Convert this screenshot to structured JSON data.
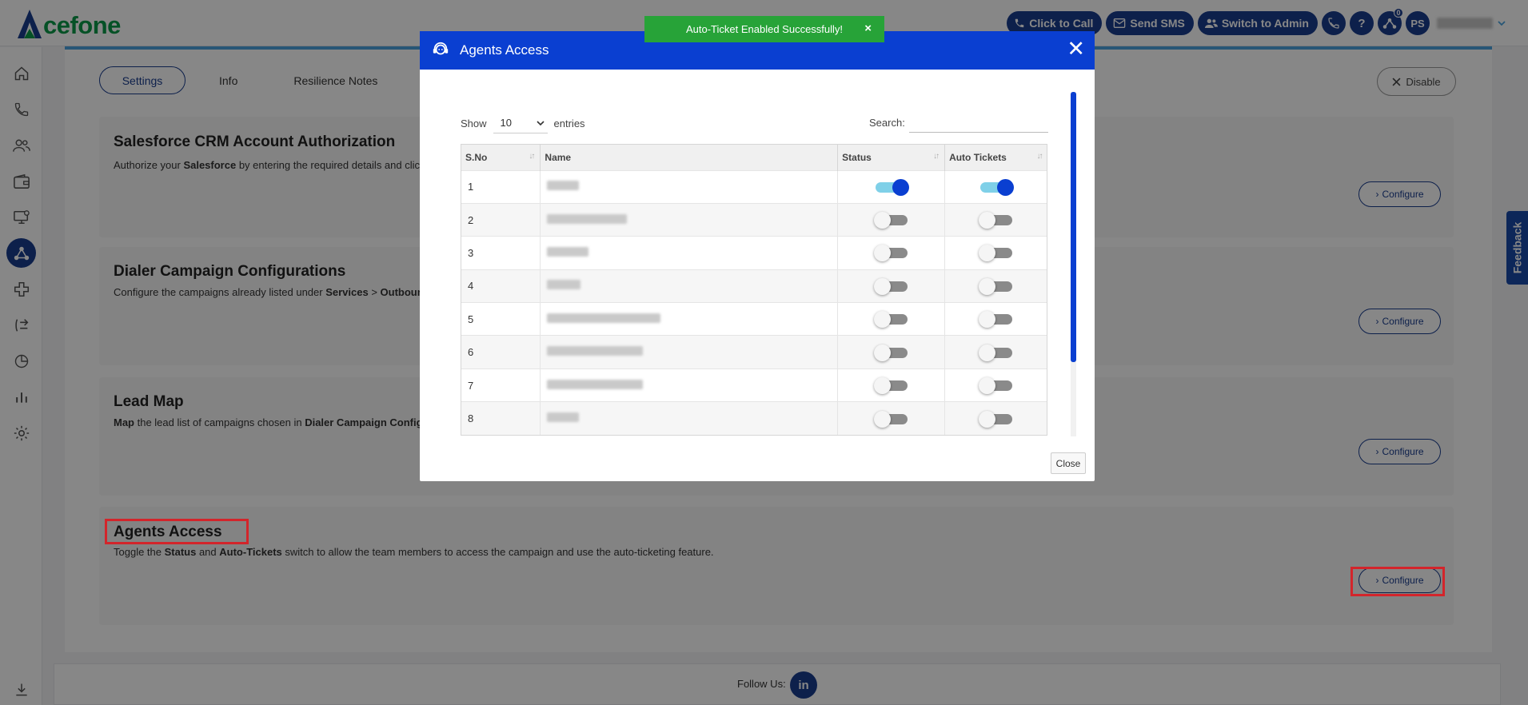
{
  "brand": {
    "logo_text": "cefone"
  },
  "header": {
    "click_to_call": "Click to Call",
    "send_sms": "Send SMS",
    "switch_to_admin": "Switch to Admin",
    "help": "?",
    "badge": "0",
    "avatar_initials": "PS"
  },
  "tabs": [
    {
      "label": "Settings",
      "active": true
    },
    {
      "label": "Info",
      "active": false
    },
    {
      "label": "Resilience Notes",
      "active": false
    }
  ],
  "disable_label": "Disable",
  "sections": [
    {
      "title": "Salesforce CRM Account Authorization",
      "desc_a": "Authorize your ",
      "desc_b": "Salesforce",
      "desc_c": " by entering the required details and clic",
      "configure": "Configure"
    },
    {
      "title": "Dialer Campaign Configurations",
      "desc_a": "Configure the campaigns already listed under ",
      "desc_b": "Services",
      "desc_c": " > ",
      "desc_d": "Outboun",
      "configure": "Configure"
    },
    {
      "title": "Lead Map",
      "desc_a": "Map",
      "desc_b": " the lead list of campaigns chosen in ",
      "desc_c": "Dialer Campaign Config",
      "configure": "Configure"
    },
    {
      "title": "Agents Access",
      "desc_a": "Toggle the ",
      "desc_b": "Status",
      "desc_c": " and ",
      "desc_d": "Auto-Tickets",
      "desc_e": " switch to allow the team members to access the campaign and use the auto-ticketing feature.",
      "configure": "Configure"
    }
  ],
  "feedback": "Feedback",
  "footer": {
    "follow_us": "Follow Us:",
    "linkedin": "in"
  },
  "toast": {
    "message": "Auto-Ticket Enabled Successfully!",
    "close": "×"
  },
  "modal": {
    "title": "Agents Access",
    "close_icon": "✕",
    "show_label": "Show",
    "entries_value": "10",
    "entries_label": "entries",
    "search_label": "Search:",
    "search_value": "",
    "columns": [
      "S.No",
      "Name",
      "Status",
      "Auto Tickets"
    ],
    "rows": [
      {
        "sno": "1",
        "status": true,
        "auto": true
      },
      {
        "sno": "2",
        "status": false,
        "auto": false
      },
      {
        "sno": "3",
        "status": false,
        "auto": false
      },
      {
        "sno": "4",
        "status": false,
        "auto": false
      },
      {
        "sno": "5",
        "status": false,
        "auto": false
      },
      {
        "sno": "6",
        "status": false,
        "auto": false
      },
      {
        "sno": "7",
        "status": false,
        "auto": false
      },
      {
        "sno": "8",
        "status": false,
        "auto": false
      }
    ],
    "close_button": "Close"
  },
  "colors": {
    "brand_blue": "#1a3d8f",
    "modal_blue": "#0a3fd1",
    "toast_green": "#27a338",
    "highlight_red": "#d3252b"
  }
}
